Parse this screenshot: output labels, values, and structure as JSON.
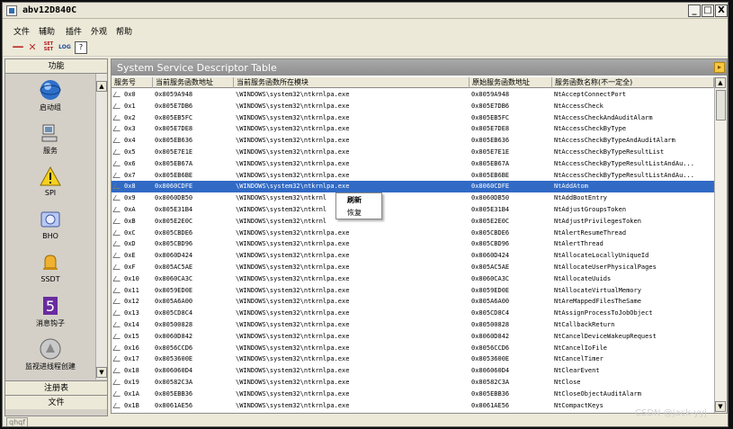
{
  "window": {
    "title": "abv12D840C",
    "minimize_label": "_",
    "maximize_label": "□",
    "close_label": "X"
  },
  "menu": [
    "文件",
    "辅助",
    "插件",
    "外观",
    "帮助"
  ],
  "toolbar": {
    "remove_icon": "minus-icon",
    "delete_icon": "x-icon",
    "set_label": "SET\nSET",
    "log_label": "LOG",
    "help_label": "?"
  },
  "left_panel": {
    "header": "功能",
    "items": [
      {
        "label": "启动组",
        "icon": "startup-globe-icon"
      },
      {
        "label": "服务",
        "icon": "computer-icon"
      },
      {
        "label": "SPI",
        "icon": "warning-icon"
      },
      {
        "label": "BHO",
        "icon": "disk-icon"
      },
      {
        "label": "SSDT",
        "icon": "bell-icon"
      },
      {
        "label": "消息钩子",
        "icon": "hook-icon"
      },
      {
        "label": "监视进线程创建",
        "icon": "monitor-icon"
      }
    ],
    "footer_items": [
      "注册表",
      "文件"
    ]
  },
  "right_panel": {
    "title": "System Service Descriptor Table",
    "columns": [
      "服务号",
      "当前服务函数地址",
      "当前服务函数所在模块",
      "原始服务函数地址",
      "服务函数名称(不一定全)"
    ],
    "rows": [
      [
        "0x0",
        "0x8059A948",
        "\\WINDOWS\\system32\\ntkrnlpa.exe",
        "0x8059A948",
        "NtAcceptConnectPort"
      ],
      [
        "0x1",
        "0x805E7DB6",
        "\\WINDOWS\\system32\\ntkrnlpa.exe",
        "0x805E7DB6",
        "NtAccessCheck"
      ],
      [
        "0x2",
        "0x805EB5FC",
        "\\WINDOWS\\system32\\ntkrnlpa.exe",
        "0x805EB5FC",
        "NtAccessCheckAndAuditAlarm"
      ],
      [
        "0x3",
        "0x805E7DE8",
        "\\WINDOWS\\system32\\ntkrnlpa.exe",
        "0x805E7DE8",
        "NtAccessCheckByType"
      ],
      [
        "0x4",
        "0x805EB636",
        "\\WINDOWS\\system32\\ntkrnlpa.exe",
        "0x805EB636",
        "NtAccessCheckByTypeAndAuditAlarm"
      ],
      [
        "0x5",
        "0x805E7E1E",
        "\\WINDOWS\\system32\\ntkrnlpa.exe",
        "0x805E7E1E",
        "NtAccessCheckByTypeResultList"
      ],
      [
        "0x6",
        "0x805EB67A",
        "\\WINDOWS\\system32\\ntkrnlpa.exe",
        "0x805EB67A",
        "NtAccessCheckByTypeResultListAndAu..."
      ],
      [
        "0x7",
        "0x805EB6BE",
        "\\WINDOWS\\system32\\ntkrnlpa.exe",
        "0x805EB6BE",
        "NtAccessCheckByTypeResultListAndAu..."
      ],
      [
        "0x8",
        "0x8060CDFE",
        "\\WINDOWS\\system32\\ntkrnlpa.exe",
        "0x8060CDFE",
        "NtAddAtom"
      ],
      [
        "0x9",
        "0x8060DB50",
        "\\WINDOWS\\system32\\ntkrnl",
        "0x8060DB50",
        "NtAddBootEntry"
      ],
      [
        "0xA",
        "0x805E31B4",
        "\\WINDOWS\\system32\\ntkrnl",
        "0x805E31B4",
        "NtAdjustGroupsToken"
      ],
      [
        "0xB",
        "0x805E2E0C",
        "\\WINDOWS\\system32\\ntkrnl",
        "0x805E2E0C",
        "NtAdjustPrivilegesToken"
      ],
      [
        "0xC",
        "0x805CBDE6",
        "\\WINDOWS\\system32\\ntkrnlpa.exe",
        "0x805CBDE6",
        "NtAlertResumeThread"
      ],
      [
        "0xD",
        "0x805CBD96",
        "\\WINDOWS\\system32\\ntkrnlpa.exe",
        "0x805CBD96",
        "NtAlertThread"
      ],
      [
        "0xE",
        "0x8060D424",
        "\\WINDOWS\\system32\\ntkrnlpa.exe",
        "0x8060D424",
        "NtAllocateLocallyUniqueId"
      ],
      [
        "0xF",
        "0x805AC5AE",
        "\\WINDOWS\\system32\\ntkrnlpa.exe",
        "0x805AC5AE",
        "NtAllocateUserPhysicalPages"
      ],
      [
        "0x10",
        "0x8060CA3C",
        "\\WINDOWS\\system32\\ntkrnlpa.exe",
        "0x8060CA3C",
        "NtAllocateUuids"
      ],
      [
        "0x11",
        "0x8059ED0E",
        "\\WINDOWS\\system32\\ntkrnlpa.exe",
        "0x8059ED0E",
        "NtAllocateVirtualMemory"
      ],
      [
        "0x12",
        "0x805A6A00",
        "\\WINDOWS\\system32\\ntkrnlpa.exe",
        "0x805A6A00",
        "NtAreMappedFilesTheSame"
      ],
      [
        "0x13",
        "0x805CD8C4",
        "\\WINDOWS\\system32\\ntkrnlpa.exe",
        "0x805CD8C4",
        "NtAssignProcessToJobObject"
      ],
      [
        "0x14",
        "0x80500828",
        "\\WINDOWS\\system32\\ntkrnlpa.exe",
        "0x80500828",
        "NtCallbackReturn"
      ],
      [
        "0x15",
        "0x8060D842",
        "\\WINDOWS\\system32\\ntkrnlpa.exe",
        "0x8060D842",
        "NtCancelDeviceWakeupRequest"
      ],
      [
        "0x16",
        "0x8056CCD6",
        "\\WINDOWS\\system32\\ntkrnlpa.exe",
        "0x8056CCD6",
        "NtCancelIoFile"
      ],
      [
        "0x17",
        "0x8053600E",
        "\\WINDOWS\\system32\\ntkrnlpa.exe",
        "0x8053600E",
        "NtCancelTimer"
      ],
      [
        "0x18",
        "0x806060D4",
        "\\WINDOWS\\system32\\ntkrnlpa.exe",
        "0x806060D4",
        "NtClearEvent"
      ],
      [
        "0x19",
        "0x80582C3A",
        "\\WINDOWS\\system32\\ntkrnlpa.exe",
        "0x80582C3A",
        "NtClose"
      ],
      [
        "0x1A",
        "0x805EBB36",
        "\\WINDOWS\\system32\\ntkrnlpa.exe",
        "0x805EBB36",
        "NtCloseObjectAuditAlarm"
      ],
      [
        "0x1B",
        "0x8061AE56",
        "\\WINDOWS\\system32\\ntkrnlpa.exe",
        "0x8061AE56",
        "NtCompactKeys"
      ]
    ],
    "selected_row": 8
  },
  "context_menu": {
    "items": [
      "刷新",
      "恢复"
    ]
  },
  "status_bar": {
    "text": "qhqf"
  },
  "watermark": "CSDN @jack-yyj"
}
